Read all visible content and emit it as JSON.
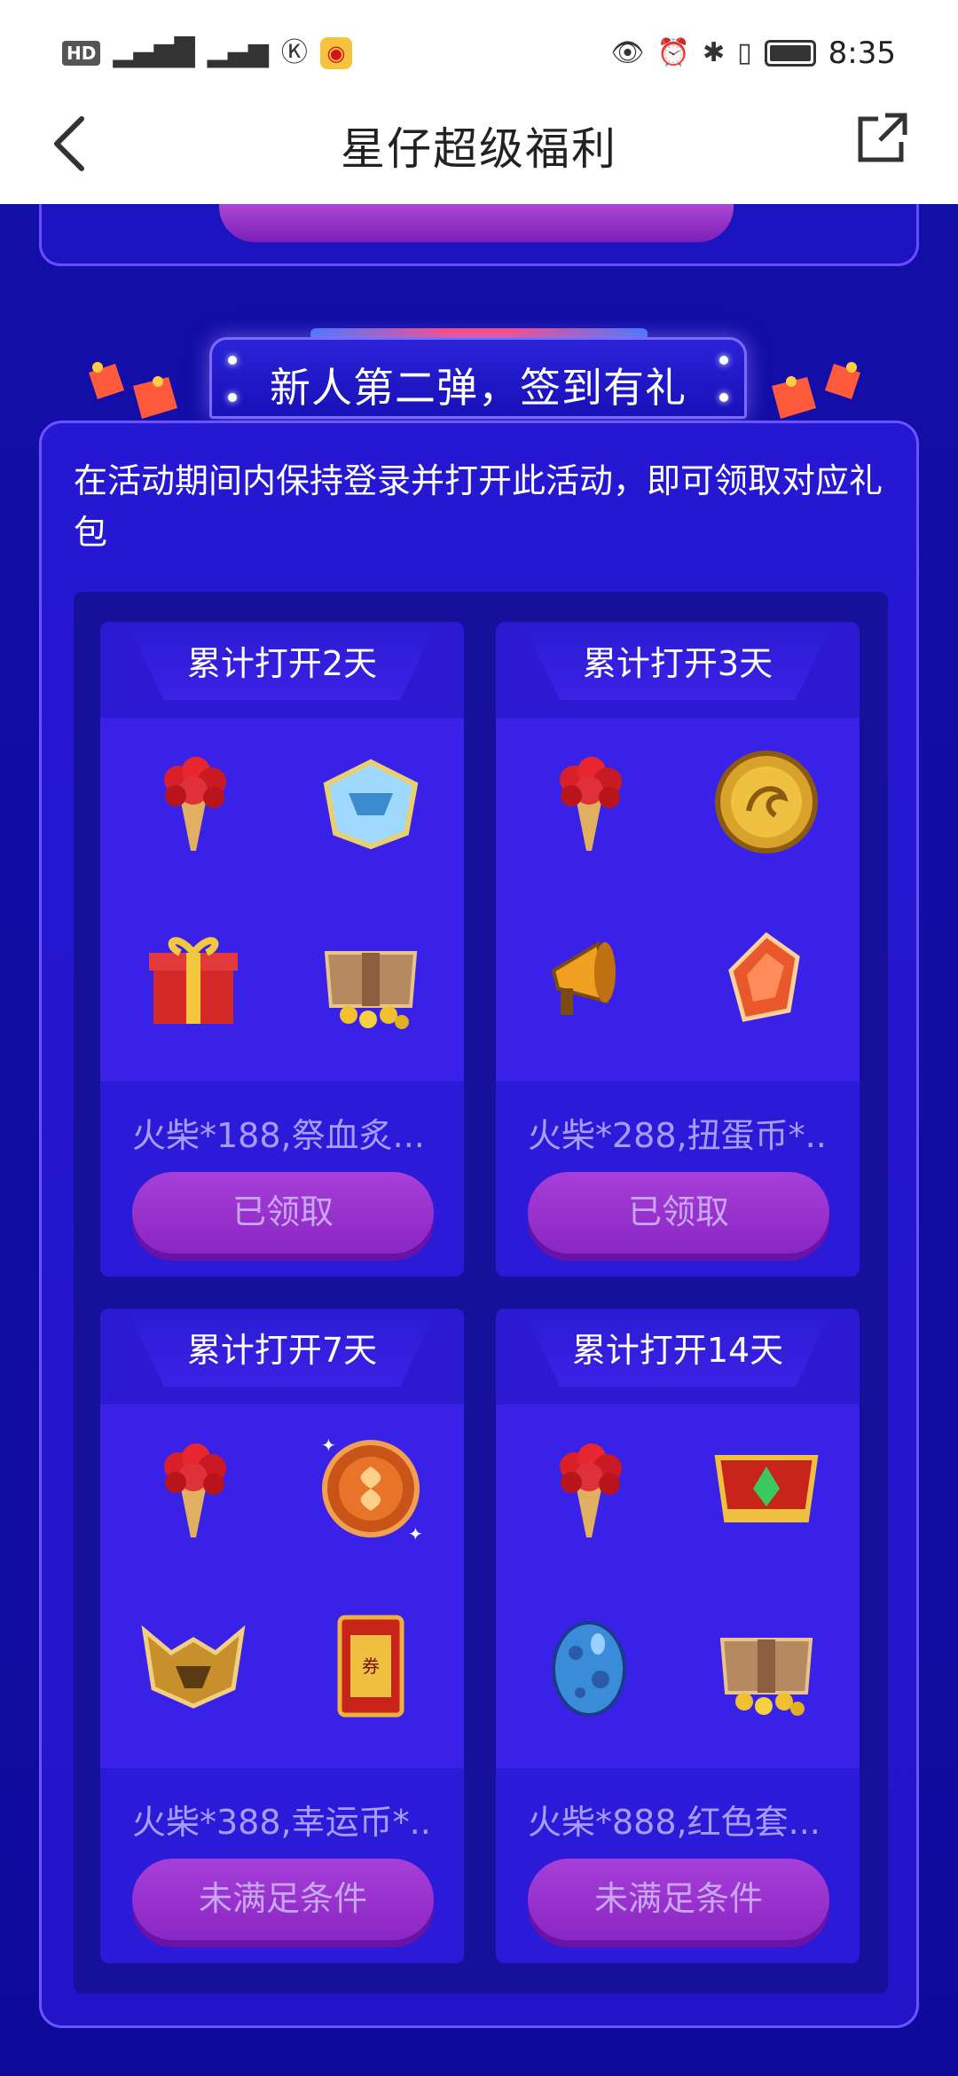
{
  "status_bar": {
    "left_icons": [
      "hd-icon",
      "signal-5g-icon",
      "signal-x-icon",
      "k-icon",
      "weibo-icon"
    ],
    "hd_label": "HD",
    "time": "8:35"
  },
  "header": {
    "title": "星仔超级福利"
  },
  "banner": {
    "title": "新人第二弹，签到有礼"
  },
  "description": "在活动期间内保持登录并打开此活动，即可领取对应礼包",
  "rewards": [
    {
      "title": "累计打开2天",
      "items": [
        "rose-bouquet-icon",
        "helmet-icon",
        "gift-box-icon",
        "treasure-chest-icon"
      ],
      "desc": "火柴*188,祭血炙...",
      "button": "已领取"
    },
    {
      "title": "累计打开3天",
      "items": [
        "rose-bouquet-icon",
        "dragon-coin-icon",
        "megaphone-icon",
        "crystal-icon"
      ],
      "desc": "火柴*288,扭蛋币*...",
      "button": "已领取"
    },
    {
      "title": "累计打开7天",
      "items": [
        "rose-bouquet-icon",
        "lucky-coin-icon",
        "horned-helmet-icon",
        "treasure-ticket-icon"
      ],
      "desc": "火柴*388,幸运币*...",
      "button": "未满足条件"
    },
    {
      "title": "累计打开14天",
      "items": [
        "rose-bouquet-icon",
        "red-crown-icon",
        "blue-egg-icon",
        "treasure-chest-icon"
      ],
      "desc": "火柴*888,红色套...",
      "button": "未满足条件"
    }
  ],
  "colors": {
    "page_bg": "#0d0aa0",
    "card_bg": "#2617d2",
    "accent_button": "#a73fd8",
    "muted_text": "#a99cff"
  }
}
